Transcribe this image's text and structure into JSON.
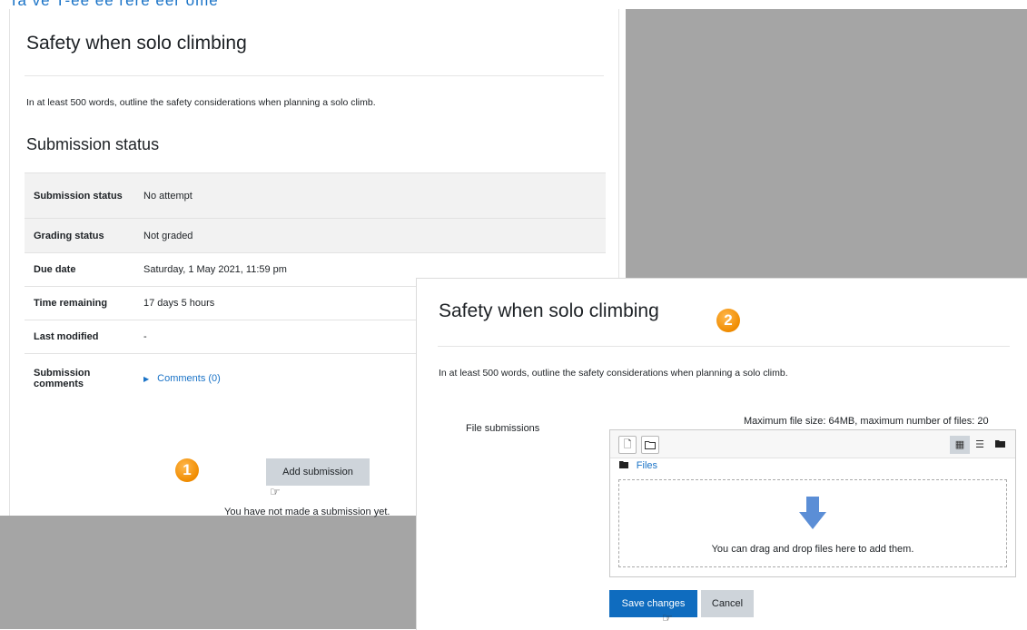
{
  "top_strip_text": "Ta ve T-ee ee rere eer ome",
  "panel1": {
    "title": "Safety when solo climbing",
    "intro": "In at least 500 words, outline the safety considerations when planning a solo climb.",
    "subheading": "Submission status",
    "rows": [
      {
        "key": "Submission status",
        "value": "No attempt"
      },
      {
        "key": "Grading status",
        "value": "Not graded"
      },
      {
        "key": "Due date",
        "value": "Saturday, 1 May 2021, 11:59 pm"
      },
      {
        "key": "Time remaining",
        "value": "17 days 5 hours"
      },
      {
        "key": "Last modified",
        "value": "-"
      },
      {
        "key": "Submission comments",
        "value": "Comments (0)"
      }
    ],
    "badge": "1",
    "add_submission": "Add submission",
    "not_submitted_note": "You have not made a submission yet."
  },
  "panel2": {
    "title": "Safety when solo climbing",
    "badge": "2",
    "intro": "In at least 500 words, outline the safety considerations when planning a solo climb.",
    "file_label": "File submissions",
    "max_info": "Maximum file size: 64MB, maximum number of files: 20",
    "files_link": "Files",
    "drop_text": "You can drag and drop files here to add them.",
    "save_label": "Save changes",
    "cancel_label": "Cancel"
  },
  "colors": {
    "accent": "#0f6cbf",
    "link": "#1a73c7",
    "badge": "#f08c00",
    "neutral_button": "#ced4da",
    "backdrop": "#a5a5a5",
    "arrow": "#5b8ed6"
  },
  "icons": [
    "add-file-icon",
    "create-folder-icon",
    "grid-view-icon",
    "list-view-icon",
    "tree-view-icon",
    "folder-icon",
    "upload-arrow-icon",
    "hand-cursor-icon",
    "caret-right-icon"
  ]
}
